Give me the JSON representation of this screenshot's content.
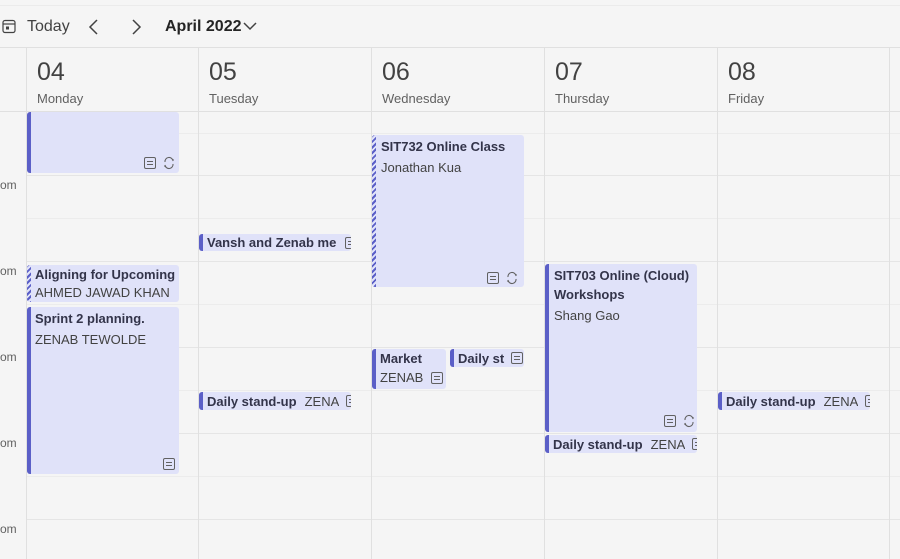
{
  "toolbar": {
    "today_label": "Today",
    "month_label": "April 2022",
    "icons": [
      "calendar-today-icon",
      "chevron-left-icon",
      "chevron-right-icon",
      "chevron-down-icon"
    ]
  },
  "days": [
    {
      "num": "04",
      "name": "Monday"
    },
    {
      "num": "05",
      "name": "Tuesday"
    },
    {
      "num": "06",
      "name": "Wednesday"
    },
    {
      "num": "07",
      "name": "Thursday"
    },
    {
      "num": "08",
      "name": "Friday"
    }
  ],
  "time_labels": [
    "om",
    "om",
    "om",
    "om",
    "om"
  ],
  "events": {
    "mon_top": {
      "title": "",
      "organizer": ""
    },
    "mon_aligning": {
      "title": "Aligning for Upcoming",
      "organizer": "AHMED JAWAD KHAN"
    },
    "mon_sprint": {
      "title": "Sprint 2 planning.",
      "organizer": "ZENAB TEWOLDE"
    },
    "tue_vansh": {
      "title": "Vansh and Zenab me"
    },
    "tue_standup": {
      "title": "Daily stand-up",
      "organizer": "ZENA"
    },
    "wed_sit732": {
      "title": "SIT732 Online Class",
      "organizer": "Jonathan Kua"
    },
    "wed_market": {
      "title": "Market",
      "organizer": "ZENAB"
    },
    "wed_daily": {
      "title": "Daily st"
    },
    "thu_sit703": {
      "title": "SIT703 Online (Cloud)",
      "title2": "Workshops",
      "organizer": "Shang Gao"
    },
    "thu_standup": {
      "title": "Daily stand-up",
      "organizer": "ZENA"
    },
    "fri_standup": {
      "title": "Daily stand-up",
      "organizer": "ZENA"
    }
  },
  "colors": {
    "event_bg": "#e0e2f9",
    "event_accent": "#5b5fc7",
    "background": "#f5f5f5"
  }
}
